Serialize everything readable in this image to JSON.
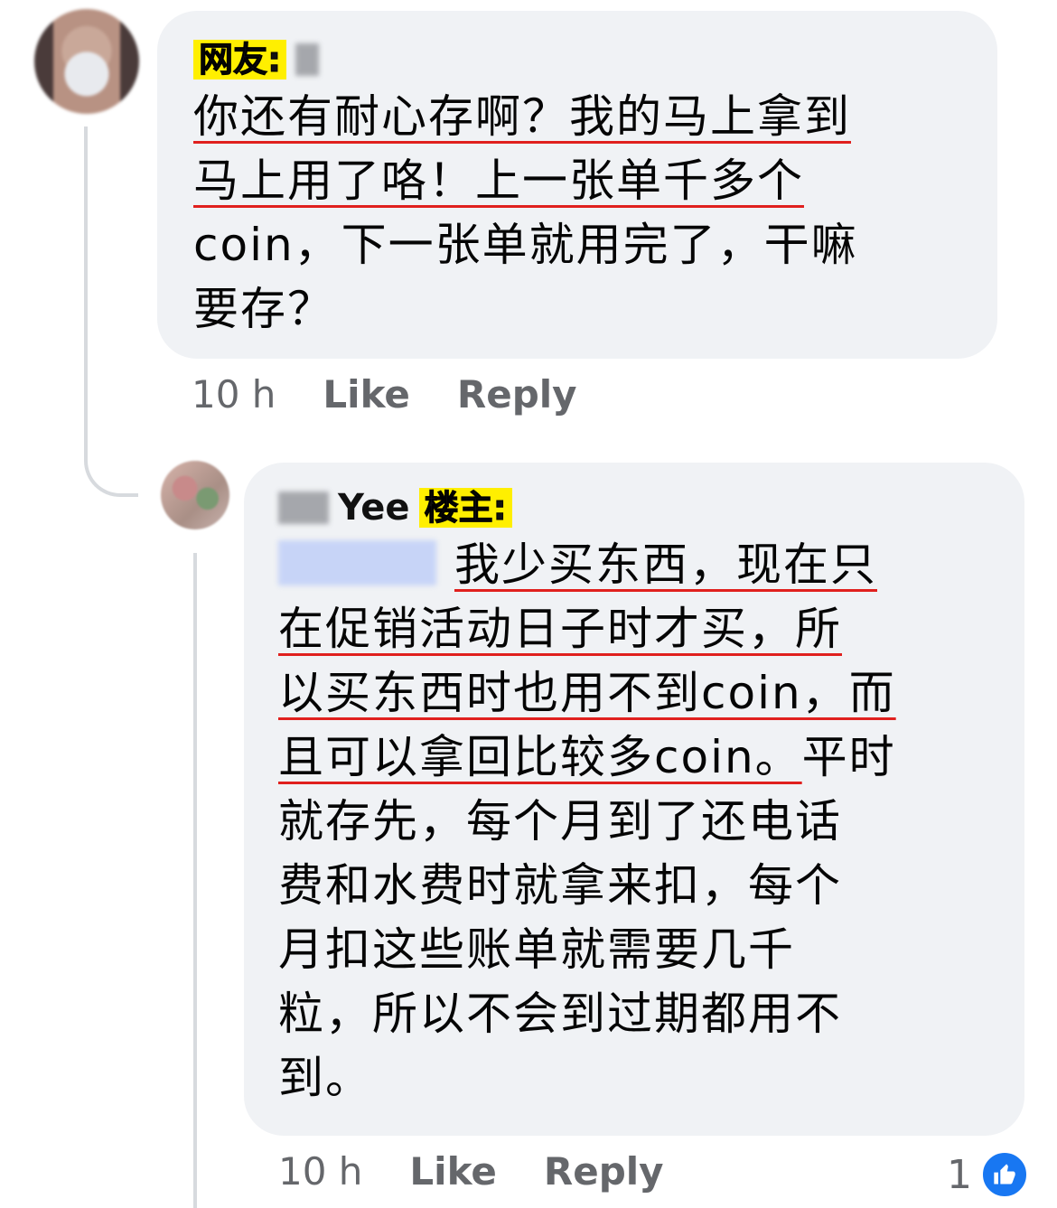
{
  "comment1": {
    "tag": "网友:",
    "lines": [
      "你还有耐心存啊？我的马上拿到",
      "马上用了咯！上一张单千多个",
      "coin，下一张单就用完了，干嘛",
      "要存？"
    ],
    "time": "10 h",
    "like": "Like",
    "reply": "Reply"
  },
  "comment2": {
    "author": "Yee",
    "tag": "楼主:",
    "line1": "我少买东西，现在只",
    "lines": [
      "在促销活动日子时才买，所",
      "以买东西时也用不到coin，而",
      "且可以拿回比较多coin。平时",
      "就存先，每个月到了还电话",
      "费和水费时就拿来扣，每个",
      "月扣这些账单就需要几千",
      "粒，所以不会到过期都用不",
      "到。"
    ],
    "line4_tail": "平时",
    "line4_head": "且可以拿回比较多coin。",
    "time": "10 h",
    "like": "Like",
    "reply": "Reply",
    "reaction_count": "1",
    "reaction_icon": "thumbs-up-icon",
    "accent_color": "#1877f2"
  }
}
